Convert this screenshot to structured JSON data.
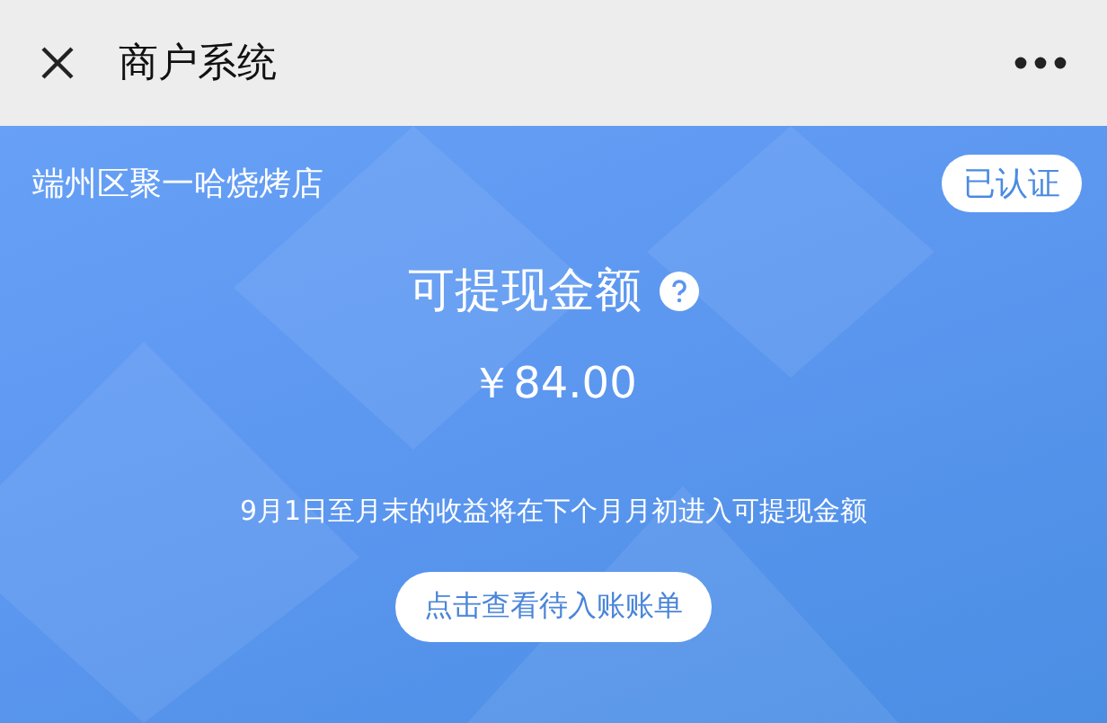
{
  "header": {
    "title": "商户系统"
  },
  "merchant": {
    "name": "端州区聚一哈烧烤店",
    "badge": "已认证"
  },
  "balance": {
    "label": "可提现金额",
    "amount": "￥84.00",
    "note": "9月1日至月末的收益将在下个月月初进入可提现金额",
    "button": "点击查看待入账账单"
  }
}
